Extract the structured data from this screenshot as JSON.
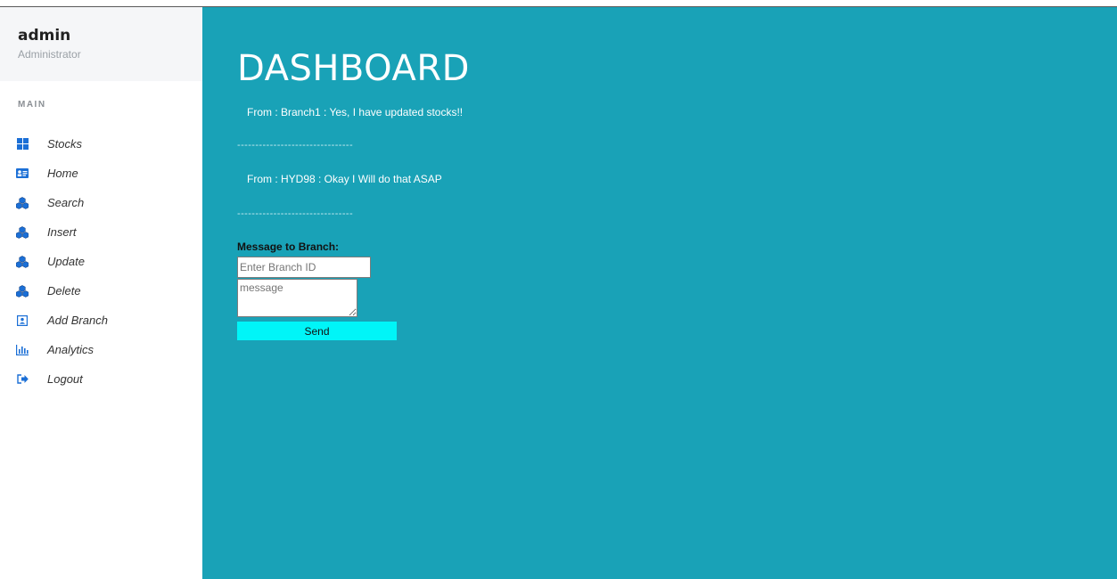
{
  "sidebar": {
    "user_name": "admin",
    "user_role": "Administrator",
    "section_label": "MAIN",
    "items": [
      {
        "label": "Stocks",
        "icon": "grid-icon"
      },
      {
        "label": "Home",
        "icon": "id-card-icon"
      },
      {
        "label": "Search",
        "icon": "cubes-icon"
      },
      {
        "label": "Insert",
        "icon": "cubes-icon"
      },
      {
        "label": "Update",
        "icon": "cubes-icon"
      },
      {
        "label": "Delete",
        "icon": "cubes-icon"
      },
      {
        "label": "Add Branch",
        "icon": "user-square-icon"
      },
      {
        "label": "Analytics",
        "icon": "bar-chart-icon"
      },
      {
        "label": "Logout",
        "icon": "sign-out-icon"
      }
    ]
  },
  "main": {
    "title": "DASHBOARD",
    "messages": [
      "From : Branch1 : Yes, I have updated stocks!!",
      "From : HYD98 : Okay I Will do that ASAP"
    ],
    "separator": "--------------------------------",
    "form": {
      "label": "Message to Branch:",
      "branch_placeholder": "Enter Branch ID",
      "message_placeholder": "message",
      "send_label": "Send"
    }
  },
  "colors": {
    "main_bg": "#19a2b7",
    "icon_blue": "#1b6fd6",
    "send_button": "#00f5f8"
  }
}
